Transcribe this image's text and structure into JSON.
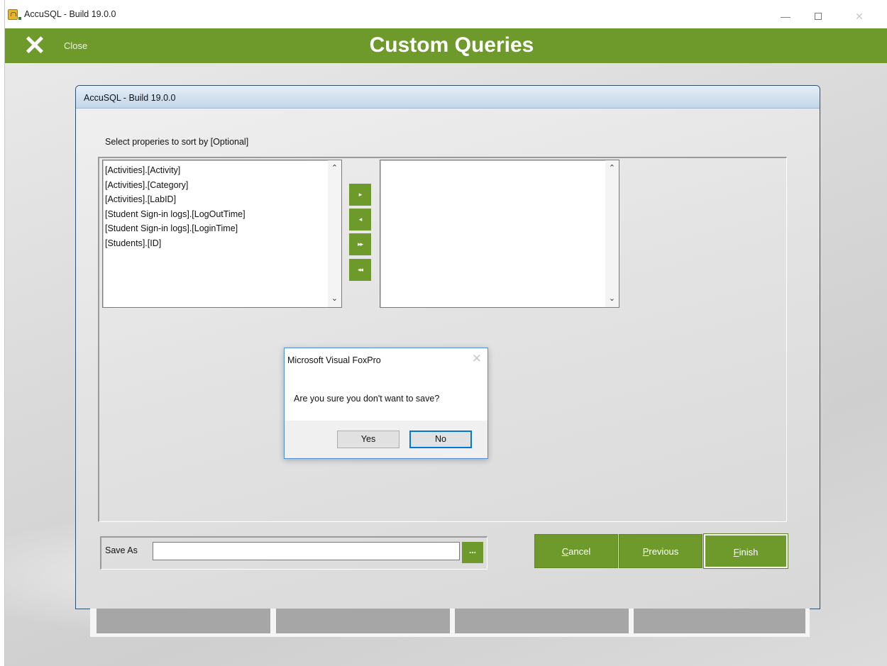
{
  "window": {
    "title": "AccuSQL - Build 19.0.0",
    "controls": {
      "minimize": "—",
      "maximize": "",
      "close": "✕"
    }
  },
  "header": {
    "close_icon": "✕",
    "close_label": "Close",
    "title": "Custom Queries",
    "accent_color": "#6e9a2b"
  },
  "form": {
    "title": "AccuSQL - Build 19.0.0",
    "prompt": "Select properies to sort by [Optional]",
    "available_fields": [
      "[Activities].[Activity]",
      "[Activities].[Category]",
      "[Activities].[LabID]",
      "[Student Sign-in logs].[LogOutTime]",
      "[Student Sign-in logs].[LoginTime]",
      "[Students].[ID]"
    ],
    "selected_fields": [],
    "scroll": {
      "up": "⌃",
      "down": "⌄"
    },
    "move_buttons": {
      "add_one": "▸",
      "remove_one": "◂",
      "add_all": "▸▸",
      "remove_all": "◂◂"
    },
    "save_as_label": "Save As",
    "save_as_value": "",
    "browse_label": "...",
    "cancel": {
      "mnemonic": "C",
      "rest": "ancel"
    },
    "previous": {
      "mnemonic": "P",
      "rest": "revious"
    },
    "finish": {
      "mnemonic": "F",
      "rest": "inish"
    }
  },
  "dialog": {
    "title": "Microsoft Visual FoxPro",
    "close_icon": "✕",
    "message": "Are you sure you don't want to save?",
    "yes": "Yes",
    "no": "No"
  }
}
